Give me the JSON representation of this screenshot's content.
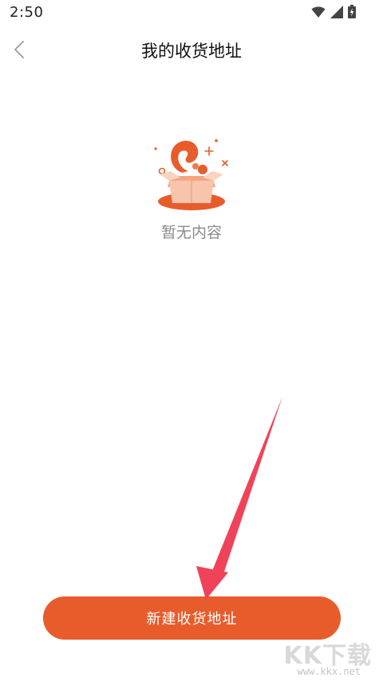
{
  "status_bar": {
    "time": "2:50",
    "icons": [
      "wifi-icon",
      "cell-signal-icon",
      "battery-charging-icon"
    ]
  },
  "header": {
    "back_icon": "chevron-left-icon",
    "title": "我的收货地址"
  },
  "empty_state": {
    "illustration": "empty-box-icon",
    "message": "暂无内容"
  },
  "actions": {
    "new_address_label": "新建收货地址"
  },
  "watermark": {
    "main": "KK下载",
    "sub": "www.kkx.net"
  },
  "colors": {
    "accent": "#e85c2c",
    "annotation_arrow": "#f0435a",
    "empty_text": "#8a8a8a"
  }
}
